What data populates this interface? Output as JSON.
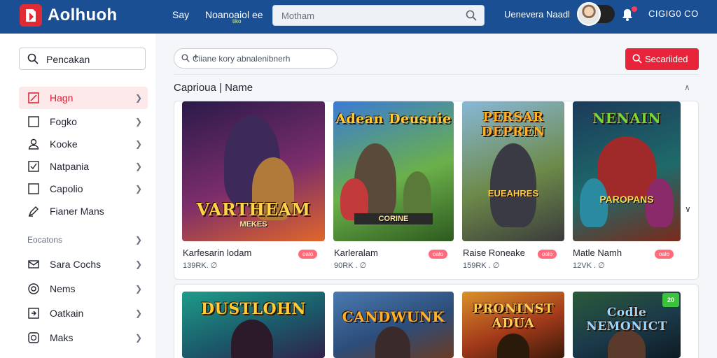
{
  "header": {
    "app_name": "Aolhuoh",
    "nav": [
      {
        "label": "Say"
      },
      {
        "label": "Noanoaiol ee"
      }
    ],
    "nav_badge": "tiko",
    "search_placeholder": "Motham",
    "user_name": "Uenevera Naadl",
    "balance": "CIGIG0 CO"
  },
  "sidebar": {
    "search_label": "Pencakan",
    "items": [
      {
        "label": "Hagn",
        "icon": "edit-square-icon",
        "active": true
      },
      {
        "label": "Fogko",
        "icon": "square-icon"
      },
      {
        "label": "Kooke",
        "icon": "user-icon"
      },
      {
        "label": "Natpania",
        "icon": "check-square-icon"
      },
      {
        "label": "Capolio",
        "icon": "square-icon"
      },
      {
        "label": "Fianer Mans",
        "icon": "pen-icon"
      }
    ],
    "section_label": "Eocatons",
    "section_items": [
      {
        "label": "Sara Cochs",
        "icon": "mail-icon"
      },
      {
        "label": "Nems",
        "icon": "circle-target-icon"
      },
      {
        "label": "Oatkain",
        "icon": "share-box-icon"
      },
      {
        "label": "Maks",
        "icon": "globe-box-icon"
      }
    ]
  },
  "main": {
    "search_placeholder": "Ciiane kory abnalenibnerh",
    "action_label": "Secariided",
    "section_title": "Caprioua | Name",
    "row1": [
      {
        "title": "Karfesarin lodam",
        "meta": "139RK. ∅",
        "badge": "oalo",
        "art_title": "VARTHEAM",
        "art_sub": "MEKES",
        "art_colors": [
          "#2a1a4a",
          "#7b2d6b",
          "#e0662a"
        ]
      },
      {
        "title": "Karleralam",
        "meta": "90RK . ∅",
        "badge": "oalo",
        "art_title": "Adean Deusuie",
        "art_sub": "CORINE",
        "art_colors": [
          "#3a7bd5",
          "#6bb04a",
          "#2d5a1f"
        ]
      },
      {
        "title": "Raise Roneake",
        "meta": "159RK . ∅",
        "badge": "oalo",
        "art_title": "PERSAR DEPREN",
        "art_sub": "EUEAHRES",
        "art_colors": [
          "#87b8d8",
          "#6d8a4a",
          "#3b3b3b"
        ]
      },
      {
        "title": "Matle Namh",
        "meta": "12VK . ∅",
        "badge": "oalo",
        "art_title": "NENAIN",
        "art_sub": "PAROPANS",
        "art_colors": [
          "#1b3a5a",
          "#1e6a6a",
          "#7a2a1a"
        ]
      }
    ],
    "row2": [
      {
        "art_title": "DUSTLOHN",
        "art_colors": [
          "#1e9c8a",
          "#1b5a6a",
          "#30224a"
        ]
      },
      {
        "art_title": "CANDWUNK",
        "art_colors": [
          "#4a7ab0",
          "#2c4d7a",
          "#6a3a22"
        ]
      },
      {
        "art_title": "PRONINST ADUA",
        "art_colors": [
          "#d9902a",
          "#a33a1a",
          "#3a1a0a"
        ]
      },
      {
        "art_title": "Codle NEMONICT",
        "art_colors": [
          "#2a5a3a",
          "#1b3a4a",
          "#0e1a22"
        ]
      }
    ],
    "new_badge": "20"
  }
}
